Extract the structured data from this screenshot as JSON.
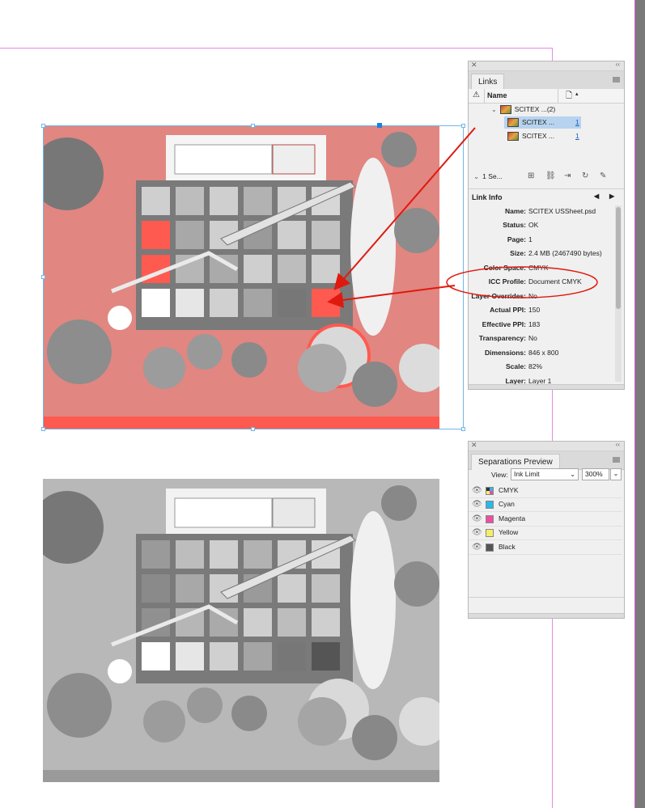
{
  "links_panel": {
    "tab": "Links",
    "column_name": "Name",
    "group_label": "SCITEX ...(2)",
    "items": [
      {
        "name": "SCITEX ...",
        "page": "1"
      },
      {
        "name": "SCITEX ...",
        "page": "1"
      }
    ],
    "selection_count": "1 Se...",
    "link_info_title": "Link Info",
    "link_info": [
      {
        "label": "Name:",
        "value": "SCITEX USSheet.psd"
      },
      {
        "label": "Status:",
        "value": "OK"
      },
      {
        "label": "Page:",
        "value": "1"
      },
      {
        "label": "Size:",
        "value": "2.4 MB (2467490 bytes)"
      },
      {
        "label": "Color Space:",
        "value": "CMYK"
      },
      {
        "label": "ICC Profile:",
        "value": "Document CMYK"
      },
      {
        "label": "Layer Overrides:",
        "value": "No"
      },
      {
        "label": "Actual PPI:",
        "value": "150"
      },
      {
        "label": "Effective PPI:",
        "value": "183"
      },
      {
        "label": "Transparency:",
        "value": "No"
      },
      {
        "label": "Dimensions:",
        "value": "846 x 800"
      },
      {
        "label": "Scale:",
        "value": "82%"
      },
      {
        "label": "Layer:",
        "value": "Layer 1"
      }
    ]
  },
  "separations_panel": {
    "tab": "Separations Preview",
    "view_label": "View:",
    "view_value": "Ink Limit",
    "ink_limit_value": "300%",
    "inks": [
      {
        "name": "CMYK",
        "color": "#multi"
      },
      {
        "name": "Cyan",
        "color": "#2bb8e8"
      },
      {
        "name": "Magenta",
        "color": "#ea4fa3"
      },
      {
        "name": "Yellow",
        "color": "#f7ec6a"
      },
      {
        "name": "Black",
        "color": "#555555"
      }
    ]
  },
  "colors": {
    "guide": "#e58ae5",
    "ink_limit_overlay": "#ff5a50",
    "annotation_red": "#e0190f",
    "selection_blue": "#1a7fe0"
  }
}
